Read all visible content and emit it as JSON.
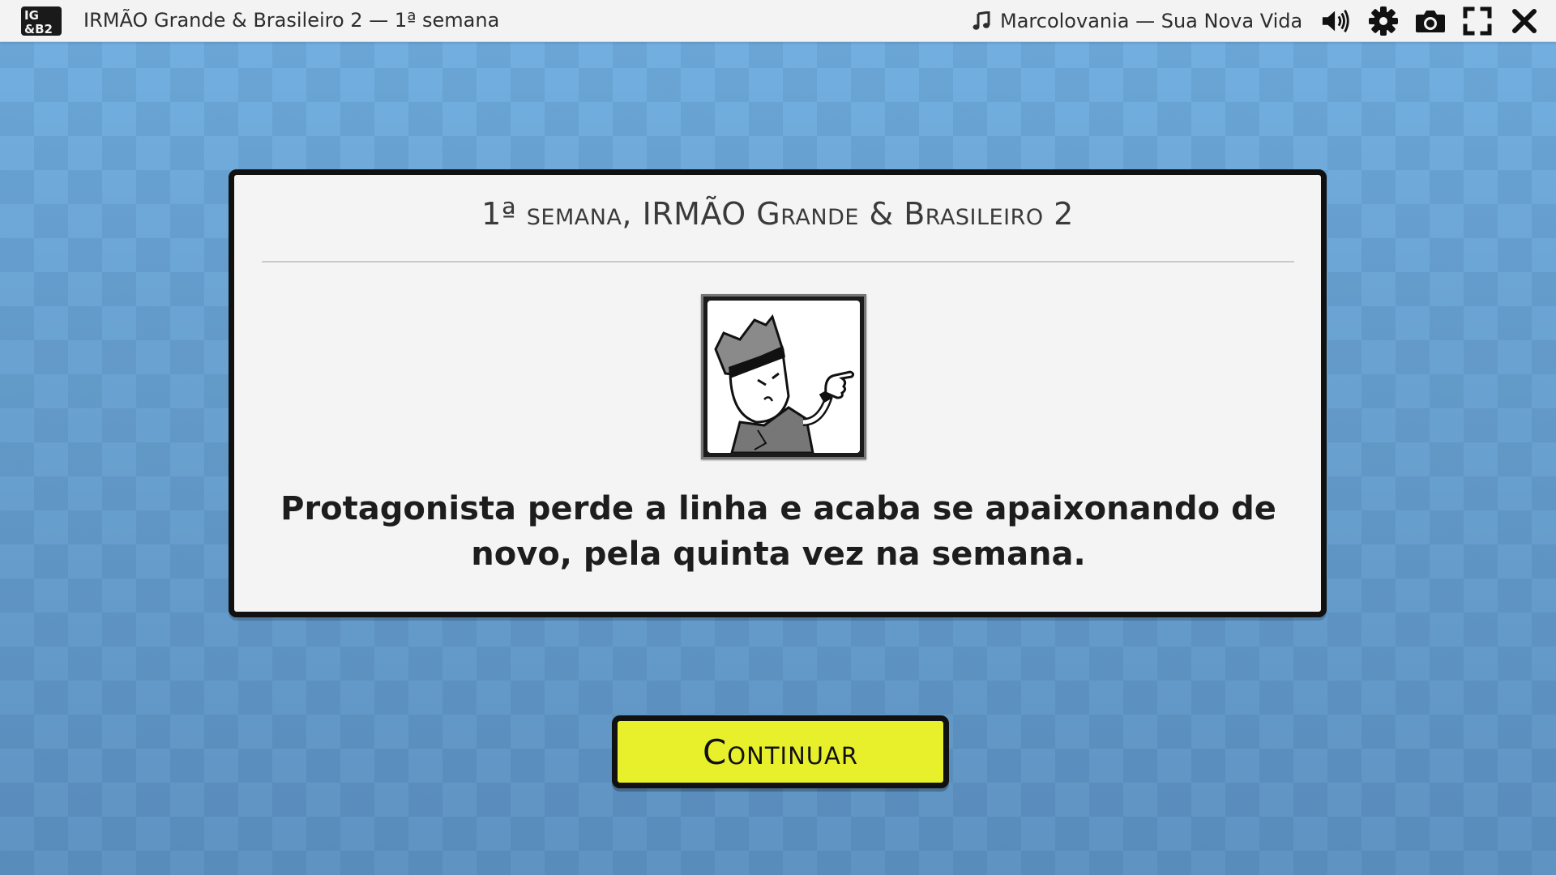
{
  "topbar": {
    "logo_text": "IG&B2",
    "app_title": "IRMÃO Grande & Brasileiro 2 — 1ª semana",
    "music_icon": "music-note-icon",
    "music_label": "Marcolovania — Sua Nova Vida",
    "tools": [
      "volume-icon",
      "gear-icon",
      "camera-icon",
      "fullscreen-icon",
      "close-icon"
    ]
  },
  "panel": {
    "title": "1ª semana, IRMÃO Grande & Brasileiro 2",
    "portrait_icon": "character-portrait",
    "message": "Protagonista perde a linha e acaba se apaixonando de novo, pela quinta vez na semana."
  },
  "continue_button": {
    "label": "Continuar",
    "color": "#e8f02c"
  },
  "colors": {
    "background": "#6aa5d3",
    "topbar": "#f3f3f3",
    "panel": "#f4f4f4",
    "border": "#111111"
  }
}
